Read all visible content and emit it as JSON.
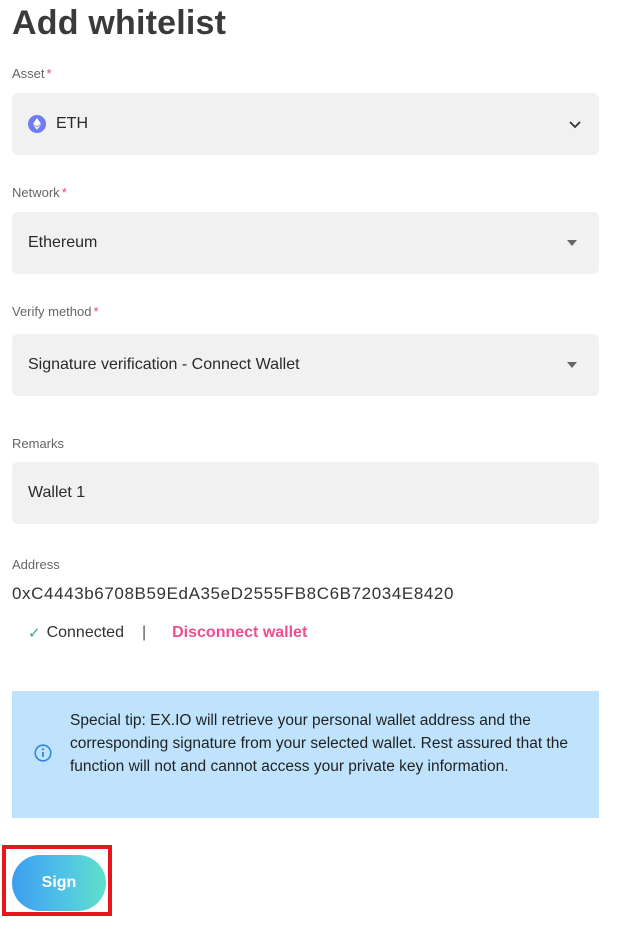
{
  "page": {
    "title": "Add whitelist"
  },
  "asset": {
    "label": "Asset",
    "required_mark": "*",
    "value": "ETH",
    "icon": "ethereum-icon"
  },
  "network": {
    "label": "Network",
    "required_mark": "*",
    "value": "Ethereum"
  },
  "verify": {
    "label": "Verify method",
    "required_mark": "*",
    "value": "Signature verification - Connect Wallet"
  },
  "remarks": {
    "label": "Remarks",
    "value": "Wallet 1"
  },
  "address": {
    "label": "Address",
    "value": "0xC4443b6708B59EdA35eD2555FB8C6B72034E8420"
  },
  "connection": {
    "check_glyph": "✓",
    "status": "Connected",
    "separator": "|",
    "disconnect_label": "Disconnect wallet"
  },
  "tip": {
    "text": "Special tip: EX.IO will retrieve your personal wallet address and the corresponding signature from your selected wallet. Rest assured that the function will not and cannot access your private key information."
  },
  "actions": {
    "sign_label": "Sign"
  },
  "colors": {
    "accent_pink": "#ee4f8e",
    "tip_bg": "#bfe3fd",
    "highlight": "#e8151b"
  }
}
